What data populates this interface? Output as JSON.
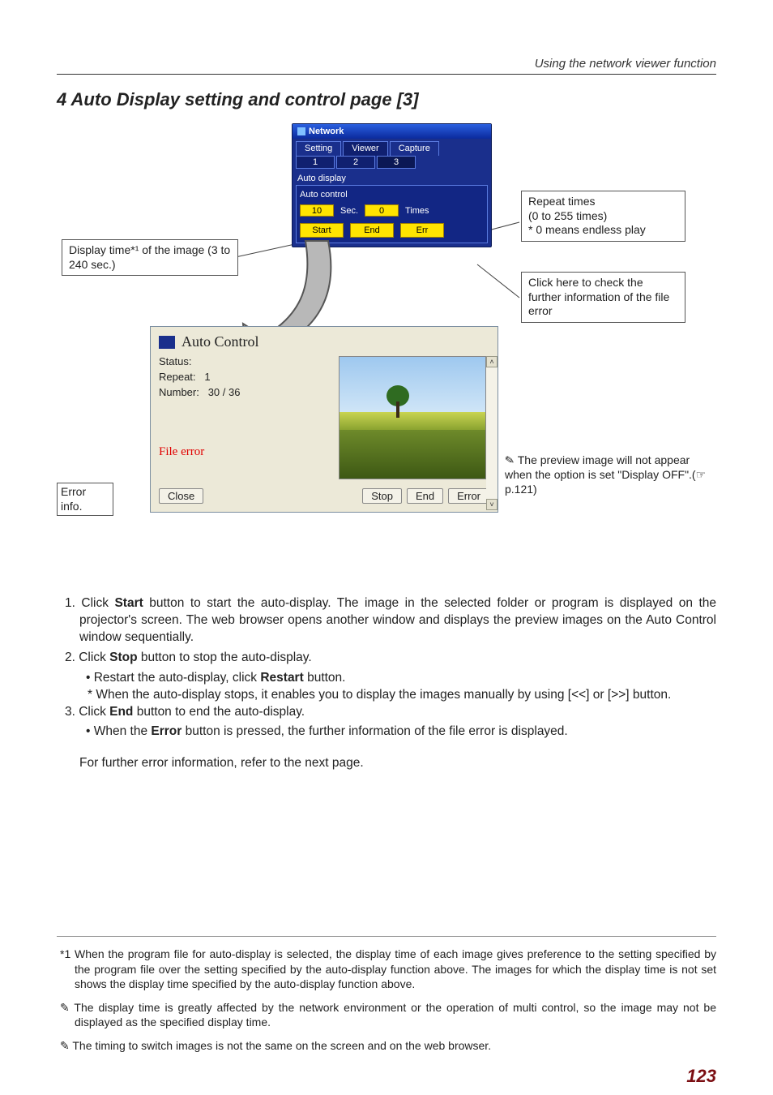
{
  "header": {
    "running": "Using the network viewer function"
  },
  "section": {
    "prefix": "4",
    "title": "Auto Display setting and control page [3]"
  },
  "netpanel": {
    "title": "Network",
    "tabs": [
      "Setting",
      "Viewer",
      "Capture"
    ],
    "subtabs": [
      "1",
      "2",
      "3"
    ],
    "label_autodisplay": "Auto display",
    "label_autocontrol": "Auto control",
    "sec_value": "10",
    "sec_label": "Sec.",
    "times_value": "0",
    "times_label": "Times",
    "btn_start": "Start",
    "btn_end": "End",
    "btn_err": "Err"
  },
  "callouts": {
    "display_time": "Display time*¹ of the image (3 to 240 sec.)",
    "repeat_times": "Repeat times\n(0 to 255 times)\n* 0 means endless play",
    "click_error": "Click here to check the further information of the file error",
    "error_info": "Error info."
  },
  "acwin": {
    "title": "Auto Control",
    "status_label": "Status:",
    "status_value": "",
    "repeat_label": "Repeat:",
    "repeat_value": "1",
    "number_label": "Number:",
    "number_value": "30 / 36",
    "file_error": "File error",
    "btn_close": "Close",
    "btn_stop": "Stop",
    "btn_end": "End",
    "btn_error": "Error"
  },
  "side_note": "The preview image will not appear when the option is set \"Display OFF\".(☞p.121)",
  "steps": {
    "s1a": "1. Click ",
    "s1b": "Start",
    "s1c": " button to start the auto-display. The image in the selected folder or program is displayed on the projector's screen. The web browser opens another window and displays the preview images on the Auto Control window sequentially.",
    "s2a": "2. Click ",
    "s2b": "Stop",
    "s2c": " button to stop the auto-display.",
    "s2_r1a": "• Restart the auto-display, click ",
    "s2_r1b": "Restart",
    "s2_r1c": " button.",
    "s2_r2": "* When the auto-display stops, it enables you to display the images manually by using [<<] or [>>] button.",
    "s3a": "3. Click ",
    "s3b": "End",
    "s3c": " button to end the auto-display.",
    "s3_r1a": "• When the ",
    "s3_r1b": "Error",
    "s3_r1c": " button is pressed, the further information of the file error is displayed.",
    "closing": "For further error information, refer to the next page."
  },
  "footnotes": {
    "f1": "*1 When the program file for auto-display is selected, the display time of each image gives preference to the setting specified by the program file over the setting specified by the auto-display function above. The images for which the display time is not set shows the display time specified by the auto-display function above.",
    "f2": "✎ The display time is greatly affected by the network environment or the operation of multi control, so the image may not be displayed as the specified display time.",
    "f3": "✎ The timing to switch images is not the same on the screen and on the web browser."
  },
  "page_number": "123"
}
